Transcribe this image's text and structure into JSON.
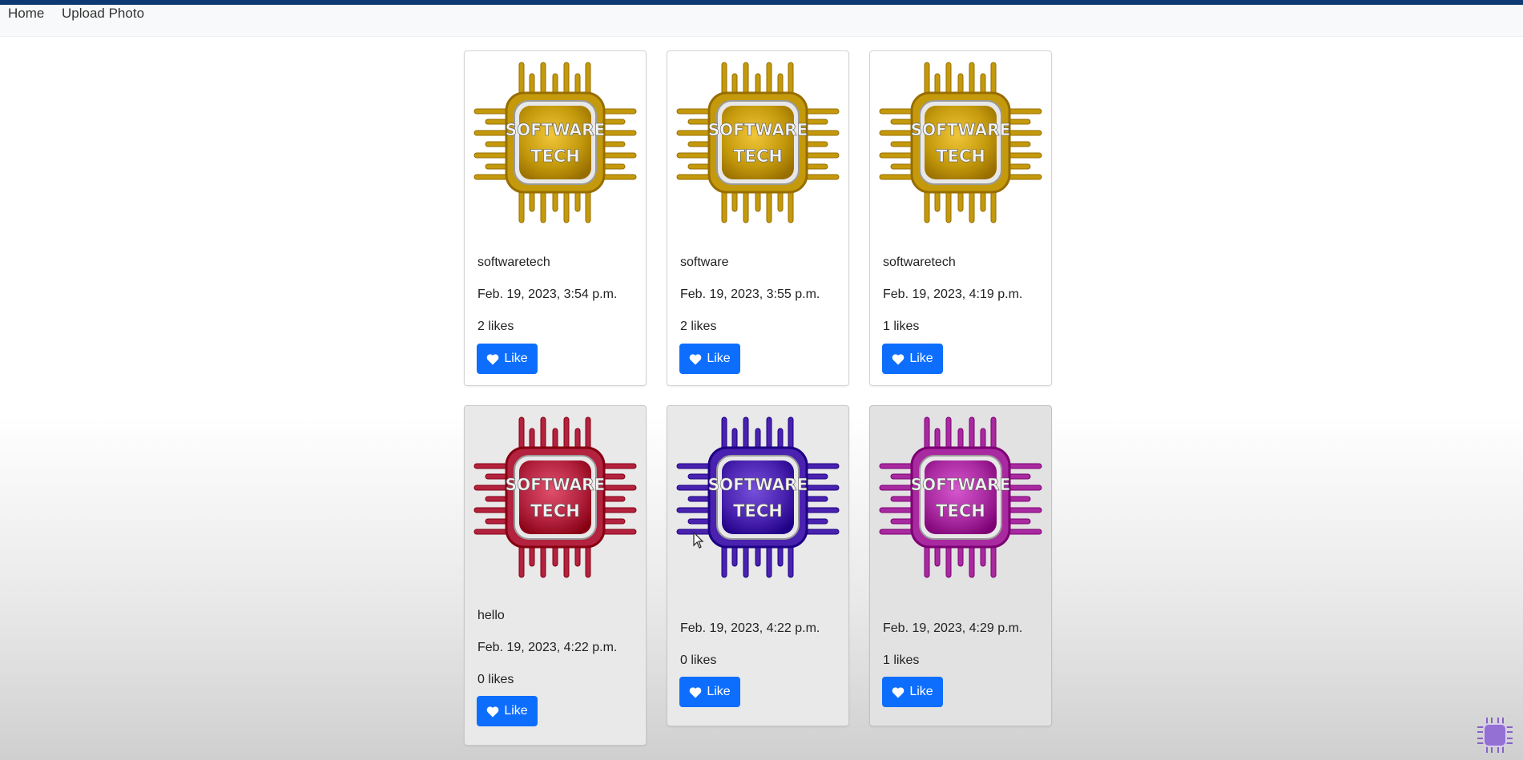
{
  "nav": {
    "home_label": "Home",
    "upload_label": "Upload Photo"
  },
  "colors": {
    "brand_bar": "#0d3a73",
    "like_button": "#0d6efd"
  },
  "like_label": "Like",
  "logo_text": {
    "line1": "SOFTWARE",
    "line2": "TECH"
  },
  "posts": [
    {
      "title": "softwaretech",
      "date": "Feb. 19, 2023, 3:54 p.m.",
      "likes": "2 likes",
      "logo_color": "#c49a0c"
    },
    {
      "title": "software",
      "date": "Feb. 19, 2023, 3:55 p.m.",
      "likes": "2 likes",
      "logo_color": "#c49a0c"
    },
    {
      "title": "softwaretech",
      "date": "Feb. 19, 2023, 4:19 p.m.",
      "likes": "1 likes",
      "logo_color": "#c49a0c"
    },
    {
      "title": "hello",
      "date": "Feb. 19, 2023, 4:22 p.m.",
      "likes": "0 likes",
      "logo_color": "#b3223e"
    },
    {
      "title": "",
      "date": "Feb. 19, 2023, 4:22 p.m.",
      "likes": "0 likes",
      "logo_color": "#4a22b0"
    },
    {
      "title": "",
      "date": "Feb. 19, 2023, 4:29 p.m.",
      "likes": "1 likes",
      "logo_color": "#a92aa0"
    }
  ]
}
